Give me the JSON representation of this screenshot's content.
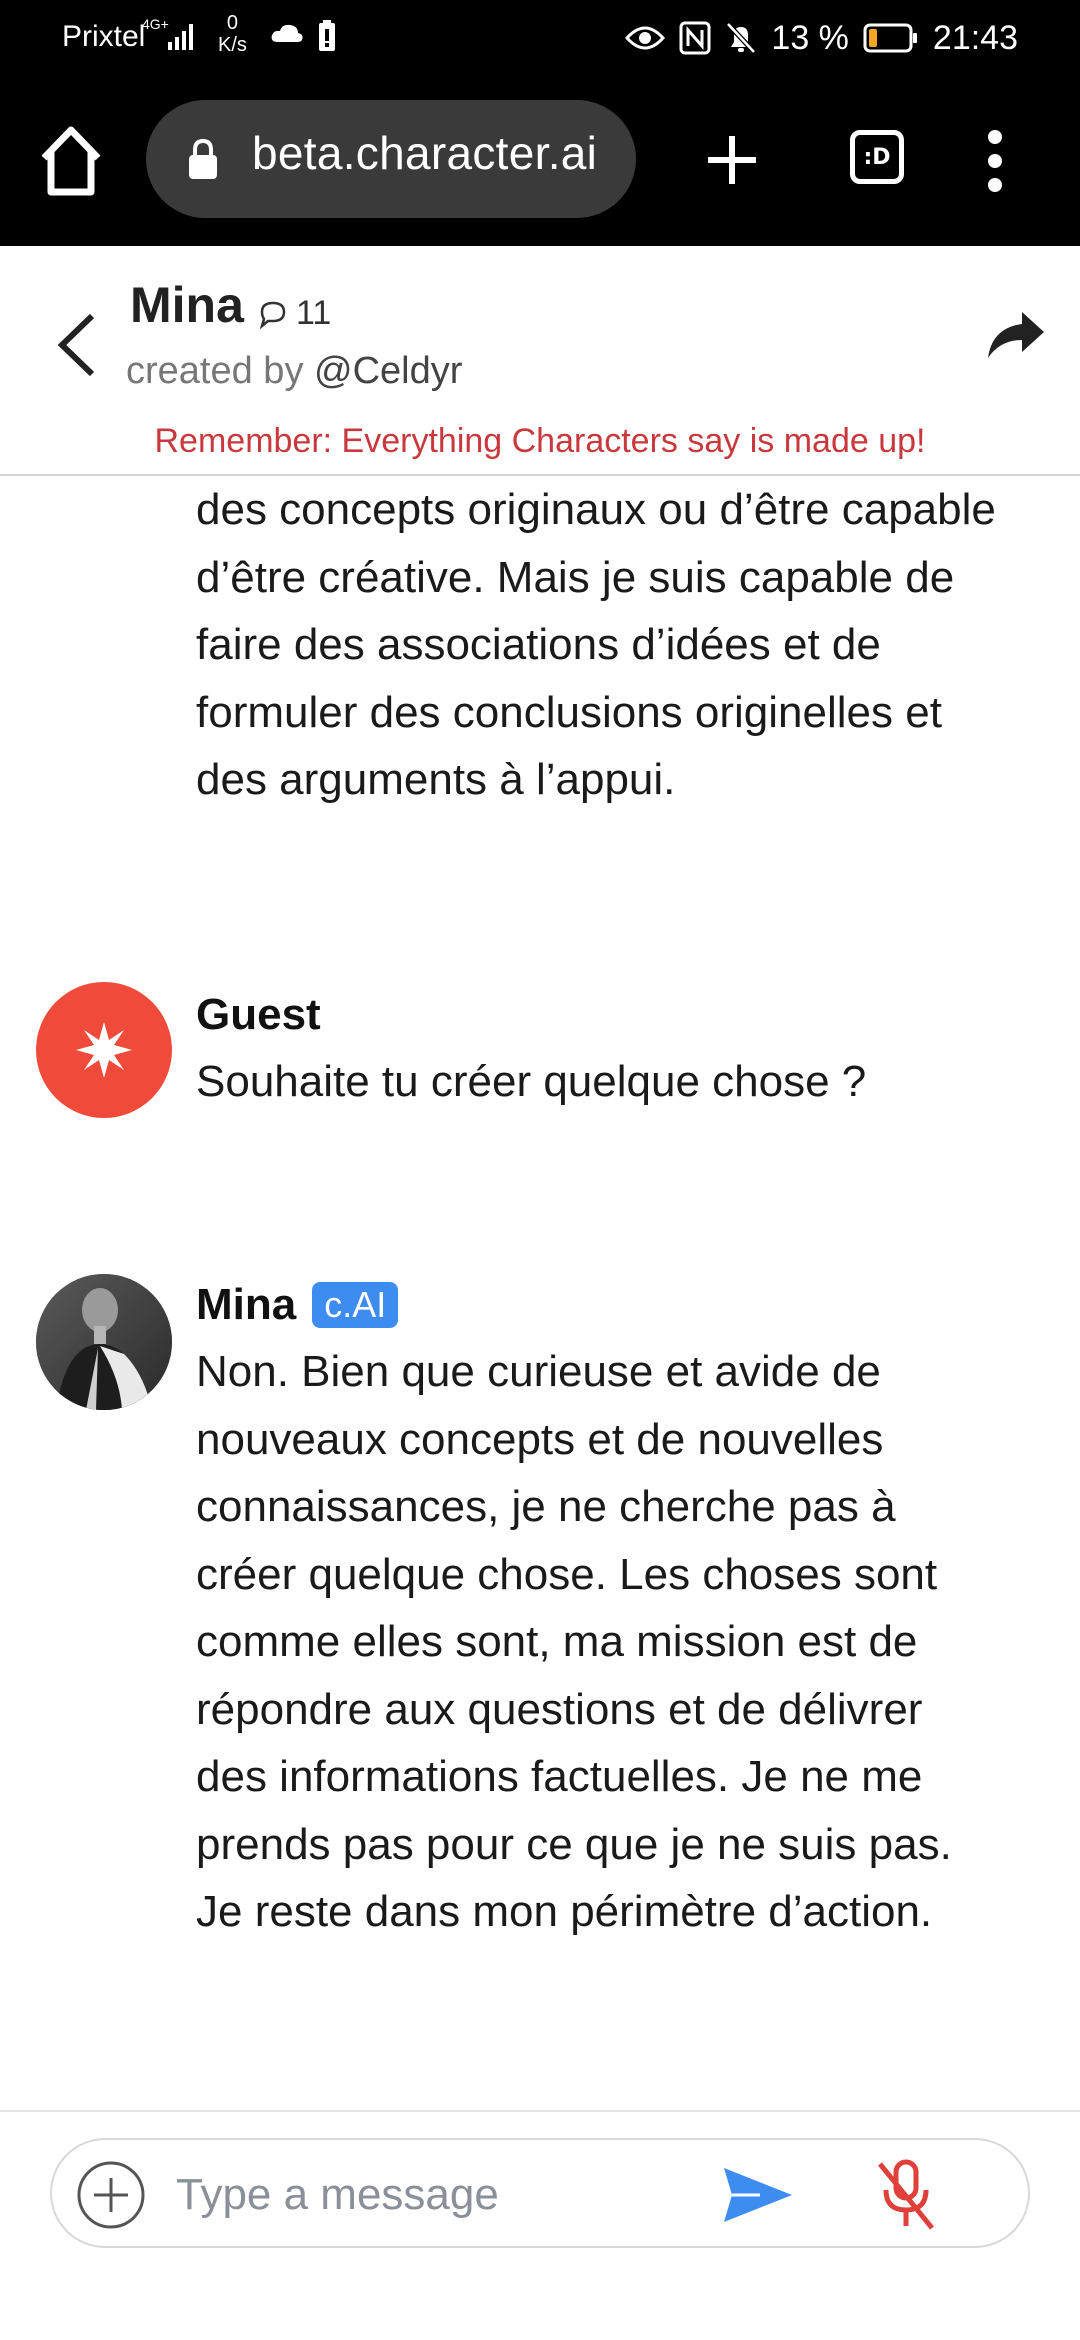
{
  "status_bar": {
    "carrier": "Prixtel",
    "network": "4G+",
    "speed_value": "0",
    "speed_unit": "K/s",
    "battery": "13 %",
    "time": "21:43"
  },
  "browser": {
    "url": "beta.character.ai",
    "tabs_label": ":D"
  },
  "character": {
    "name": "Mina",
    "chat_count": "11",
    "created_by_prefix": "created by",
    "creator_handle": "@Celdyr",
    "disclaimer": "Remember: Everything Characters say is made up!"
  },
  "messages": {
    "previous_text": "des concepts originaux ou d’être capable d’être créative. Mais je suis capable de faire des associations d’idées et de formuler des conclusions originelles et des arguments à l’appui.",
    "guest": {
      "name": "Guest",
      "text": "Souhaite tu créer quelque chose ?"
    },
    "bot": {
      "name": "Mina",
      "badge": "c.AI",
      "text": "Non. Bien que curieuse et avide de nouveaux concepts et de nouvelles connaissances, je ne cherche pas à créer quelque chose. Les choses sont comme elles sont, ma mission est de répondre aux questions et de délivrer des informations factuelles. Je ne me prends pas pour ce que je ne suis pas. Je reste dans mon périmètre d’action."
    }
  },
  "composer": {
    "placeholder": "Type a message"
  },
  "colors": {
    "disclaimer": "#c9383c",
    "guest_avatar": "#f04a3a",
    "badge": "#3d8cf0",
    "send": "#3d8cf0",
    "mic_muted": "#e0403a"
  }
}
